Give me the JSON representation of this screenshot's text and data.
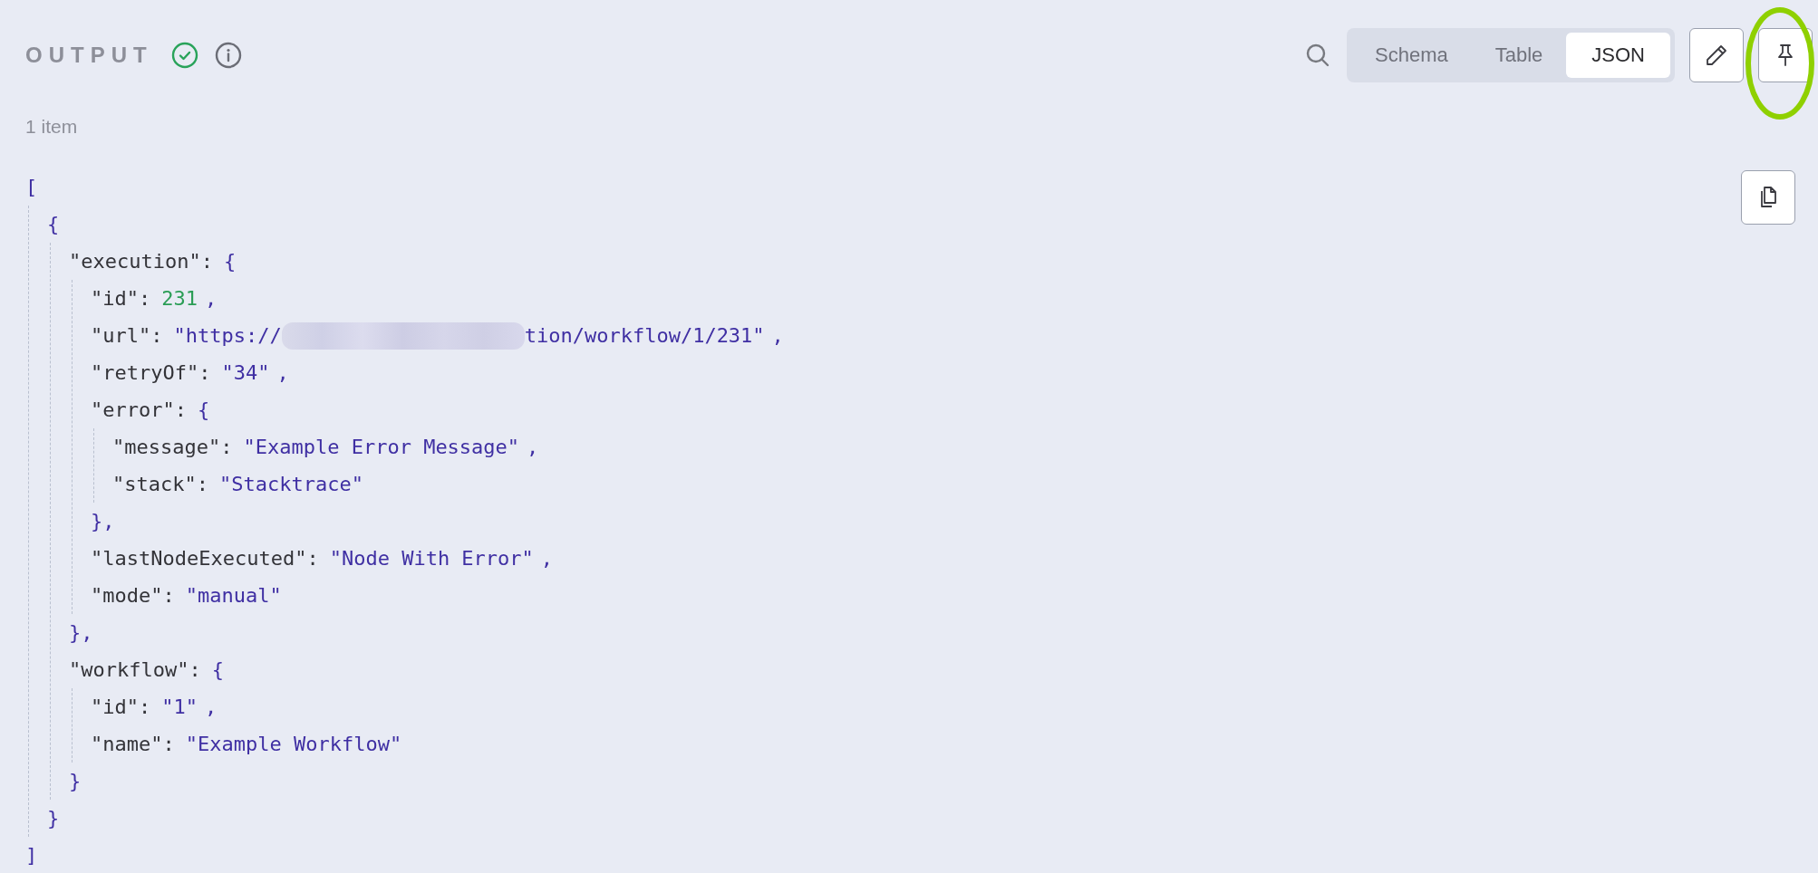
{
  "header": {
    "title": "OUTPUT",
    "success": true
  },
  "view_tabs": [
    {
      "label": "Schema",
      "selected": false
    },
    {
      "label": "Table",
      "selected": false
    },
    {
      "label": "JSON",
      "selected": true
    }
  ],
  "pin_button": {
    "highlighted": true
  },
  "item_count": "1 item",
  "json_tree": {
    "open": "[",
    "close": "]",
    "children": [
      {
        "open": "{",
        "close": "}",
        "children": [
          {
            "key": "\"execution\":",
            "open": "{",
            "close": "},",
            "children": [
              {
                "key": "\"id\":",
                "value": "231",
                "kind": "number",
                "comma": ","
              },
              {
                "key": "\"url\":",
                "value": "\"https://",
                "redacted": true,
                "value_rest": "tion/workflow/1/231\"",
                "kind": "string",
                "comma": ","
              },
              {
                "key": "\"retryOf\":",
                "value": "\"34\"",
                "kind": "string",
                "comma": ","
              },
              {
                "key": "\"error\":",
                "open": "{",
                "close": "},",
                "children": [
                  {
                    "key": "\"message\":",
                    "value": "\"Example Error Message\"",
                    "kind": "string",
                    "comma": ","
                  },
                  {
                    "key": "\"stack\":",
                    "value": "\"Stacktrace\"",
                    "kind": "string"
                  }
                ]
              },
              {
                "key": "\"lastNodeExecuted\":",
                "value": "\"Node With Error\"",
                "kind": "string",
                "comma": ","
              },
              {
                "key": "\"mode\":",
                "value": "\"manual\"",
                "kind": "string"
              }
            ]
          },
          {
            "key": "\"workflow\":",
            "open": "{",
            "close": "}",
            "children": [
              {
                "key": "\"id\":",
                "value": "\"1\"",
                "kind": "string",
                "comma": ","
              },
              {
                "key": "\"name\":",
                "value": "\"Example Workflow\"",
                "kind": "string"
              }
            ]
          }
        ]
      }
    ]
  }
}
